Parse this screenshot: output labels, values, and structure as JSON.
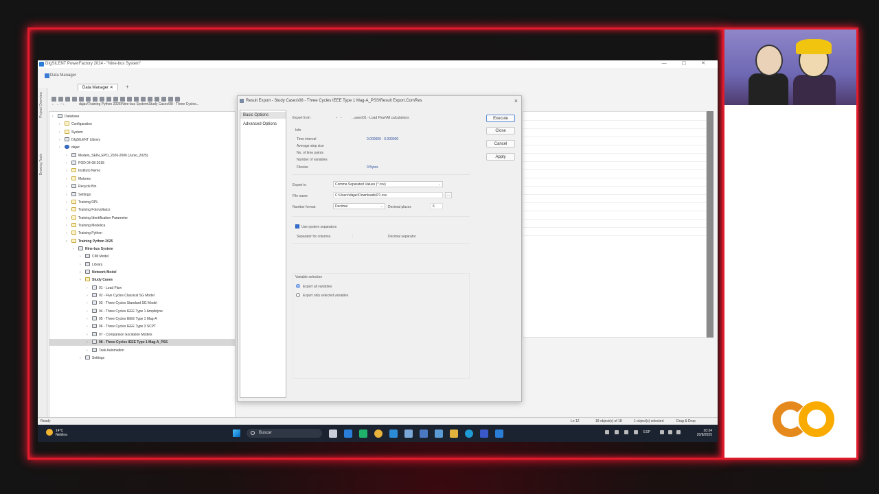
{
  "app": {
    "title": "DIgSILENT PowerFactory 2024 - \"Nine-bus System\"",
    "data_manager_title": "Data Manager",
    "data_manager_tab": "Data Manager",
    "side_tabs": [
      "Project Overview",
      "Drawing Tools"
    ],
    "path": "dajac\\Training Python 2025\\Nine-bus System\\Study Cases\\08 - Three Cycles..."
  },
  "tree": [
    {
      "label": "Database",
      "level": 0,
      "icon": "grid",
      "bold": false
    },
    {
      "label": "Configuration",
      "level": 1,
      "icon": "folder",
      "bold": false
    },
    {
      "label": "System",
      "level": 1,
      "icon": "folder",
      "bold": false
    },
    {
      "label": "DIgSILENT Library",
      "level": 1,
      "icon": "grid",
      "bold": false
    },
    {
      "label": "dajac",
      "level": 1,
      "icon": "user",
      "bold": false
    },
    {
      "label": "Modelo_SEIN_EPO_2026-2006 (Junio_2025)",
      "level": 2,
      "icon": "grid",
      "bold": false
    },
    {
      "label": "POD 04-08-2018",
      "level": 2,
      "icon": "grid",
      "bold": false
    },
    {
      "label": "Instituto Nemo",
      "level": 2,
      "icon": "folder",
      "bold": false
    },
    {
      "label": "Motores",
      "level": 2,
      "icon": "folder",
      "bold": false
    },
    {
      "label": "Recycle Bin",
      "level": 2,
      "icon": "grid",
      "bold": false
    },
    {
      "label": "Settings",
      "level": 2,
      "icon": "grid",
      "bold": false
    },
    {
      "label": "Training DPL",
      "level": 2,
      "icon": "folder",
      "bold": false
    },
    {
      "label": "Training Fotovoltaico",
      "level": 2,
      "icon": "folder",
      "bold": false
    },
    {
      "label": "Training Identification Parameter",
      "level": 2,
      "icon": "folder",
      "bold": false
    },
    {
      "label": "Training Modelica",
      "level": 2,
      "icon": "folder",
      "bold": false
    },
    {
      "label": "Training Python",
      "level": 2,
      "icon": "folder",
      "bold": false
    },
    {
      "label": "Training Python 2025",
      "level": 2,
      "icon": "folder",
      "bold": true
    },
    {
      "label": "Nine-bus System",
      "level": 3,
      "icon": "grid",
      "bold": true
    },
    {
      "label": "CIM Model",
      "level": 4,
      "icon": "grid",
      "bold": false
    },
    {
      "label": "Library",
      "level": 4,
      "icon": "grid",
      "bold": false
    },
    {
      "label": "Network Model",
      "level": 4,
      "icon": "grid",
      "bold": true
    },
    {
      "label": "Study Cases",
      "level": 4,
      "icon": "folder",
      "bold": true
    },
    {
      "label": "01 - Load Flow",
      "level": 5,
      "icon": "grid",
      "bold": false
    },
    {
      "label": "02 - Five Cycles Classical SG Model",
      "level": 5,
      "icon": "grid",
      "bold": false
    },
    {
      "label": "03 - Three Cycles Standard SG Model",
      "level": 5,
      "icon": "grid",
      "bold": false
    },
    {
      "label": "04 - Three Cycles IEEE Type 1 Amplidyne",
      "level": 5,
      "icon": "grid",
      "bold": false
    },
    {
      "label": "05 - Three Cycles IEEE Type 1 Mag-A",
      "level": 5,
      "icon": "grid",
      "bold": false
    },
    {
      "label": "06 - Three Cycles IEEE Type 3 SCPT",
      "level": 5,
      "icon": "grid",
      "bold": false
    },
    {
      "label": "07 - Comparison Excitation Models",
      "level": 5,
      "icon": "grid",
      "bold": false
    },
    {
      "label": "08 - Three Cycles IEEE Type 1 Mag-A_PSS",
      "level": 5,
      "icon": "grid",
      "bold": true,
      "selected": true
    },
    {
      "label": "Task Automation",
      "level": 5,
      "icon": "grid",
      "bold": false
    },
    {
      "label": "Settings",
      "level": 4,
      "icon": "grid",
      "bold": false
    }
  ],
  "dialog": {
    "title": "Result Export - Study Cases\\08 - Three Cycles IEEE Type 1 Mag-A_PSS\\Result Export.ComRes",
    "nav": [
      "Basic Options",
      "Advanced Options"
    ],
    "export_from_label": "Export from",
    "export_from_value": "...ases\\01 - Load Flow\\All calculations",
    "info_label": "Info",
    "time_interval_label": "Time interval",
    "time_interval_value": "0.000000 - 0.000000",
    "avg_step_label": "Average step size",
    "num_points_label": "No. of time points",
    "num_vars_label": "Number of variables",
    "filesize_label": "Filesize",
    "filesize_value": "0 Bytes",
    "export_to_label": "Export to",
    "export_to_value": "Comma Separated Values (*.csv)",
    "file_name_label": "File name",
    "file_name_value": "C:\\Users\\dajac\\Downloads\\P1.csv",
    "number_format_label": "Number format",
    "number_format_value": "Decimal",
    "decimal_places_label": "Decimal places",
    "decimal_places_value": "6",
    "use_system_sep_label": "Use system separators",
    "sep_columns_label": "Separator for columns",
    "sep_columns_value": ";",
    "decimal_sep_label": "Decimal separator",
    "decimal_sep_value": ".",
    "var_selection_label": "Variable selection",
    "export_all_label": "Export all variables",
    "export_selected_label": "Export only selected variables",
    "buttons": {
      "execute": "Execute",
      "close": "Close",
      "cancel": "Cancel",
      "apply": "Apply"
    }
  },
  "status": {
    "ready": "Ready",
    "line": "Ln 12",
    "objects": "18 object(s) of 18",
    "selected": "1 object(s) selected",
    "drag": "Drag & Drop"
  },
  "taskbar": {
    "weather_temp": "14°C",
    "weather_desc": "Neblina",
    "search": "Buscar",
    "lang": "ESP",
    "time": "20:34",
    "date": "20/8/2025"
  }
}
